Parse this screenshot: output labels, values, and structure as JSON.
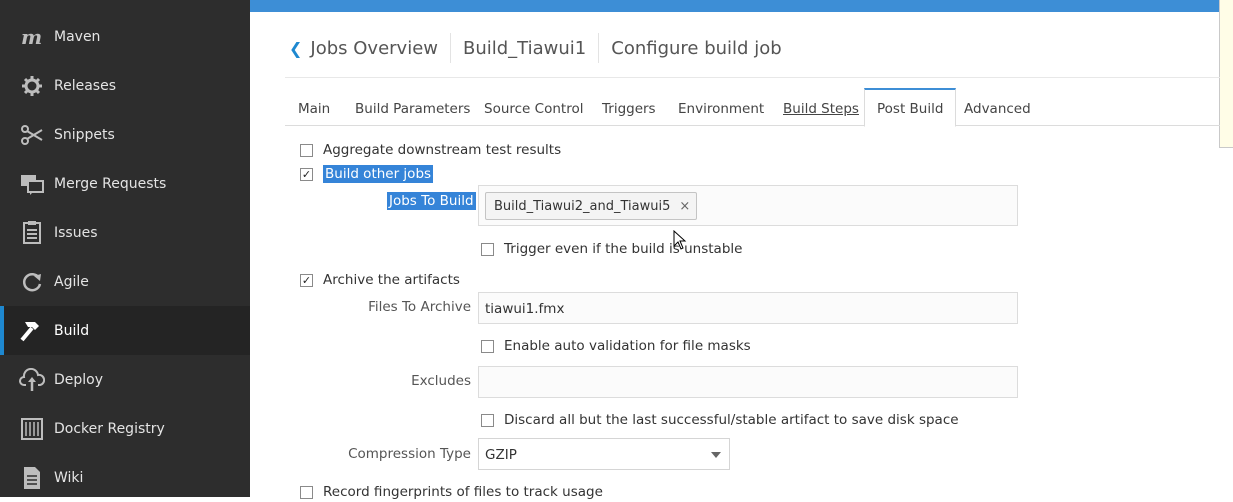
{
  "sidebar": {
    "items": [
      {
        "label": "Maven",
        "icon": "maven-icon"
      },
      {
        "label": "Releases",
        "icon": "releases-gear-icon"
      },
      {
        "label": "Snippets",
        "icon": "snippets-scissors-icon"
      },
      {
        "label": "Merge Requests",
        "icon": "merge-requests-icon"
      },
      {
        "label": "Issues",
        "icon": "issues-icon"
      },
      {
        "label": "Agile",
        "icon": "agile-cycle-icon"
      },
      {
        "label": "Build",
        "icon": "build-hammer-icon",
        "active": true
      },
      {
        "label": "Deploy",
        "icon": "deploy-cloud-icon"
      },
      {
        "label": "Docker Registry",
        "icon": "docker-registry-icon"
      },
      {
        "label": "Wiki",
        "icon": "wiki-document-icon"
      }
    ]
  },
  "header": {
    "back_icon": "chevron-left-icon",
    "breadcrumb": [
      "Jobs Overview",
      "Build_Tiawui1",
      "Configure build job"
    ]
  },
  "tabs": [
    "Main",
    "Build Parameters",
    "Source Control",
    "Triggers",
    "Environment",
    "Build Steps",
    "Post Build",
    "Advanced"
  ],
  "active_tab": "Post Build",
  "form": {
    "aggregate": {
      "label": "Aggregate downstream test results",
      "checked": false
    },
    "build_other": {
      "label": "Build other jobs",
      "checked": true
    },
    "jobs_to_build": {
      "label": "Jobs To Build",
      "chip": "Build_Tiawui2_and_Tiawui5",
      "chip_remove": "×"
    },
    "trigger_unstable": {
      "label": "Trigger even if the build is unstable",
      "checked": false
    },
    "archive": {
      "label": "Archive the artifacts",
      "checked": true
    },
    "files_to_archive": {
      "label": "Files To Archive",
      "value": "tiawui1.fmx"
    },
    "auto_validation": {
      "label": "Enable auto validation for file masks",
      "checked": false
    },
    "excludes": {
      "label": "Excludes",
      "value": ""
    },
    "discard": {
      "label": "Discard all but the last successful/stable artifact to save disk space",
      "checked": false
    },
    "compression": {
      "label": "Compression Type",
      "value": "GZIP"
    },
    "fingerprints": {
      "label": "Record fingerprints of files to track usage",
      "checked": false
    }
  },
  "colors": {
    "accent": "#1e88d0",
    "sidebar_bg": "#2d2d2d",
    "selection": "#3584d8"
  }
}
